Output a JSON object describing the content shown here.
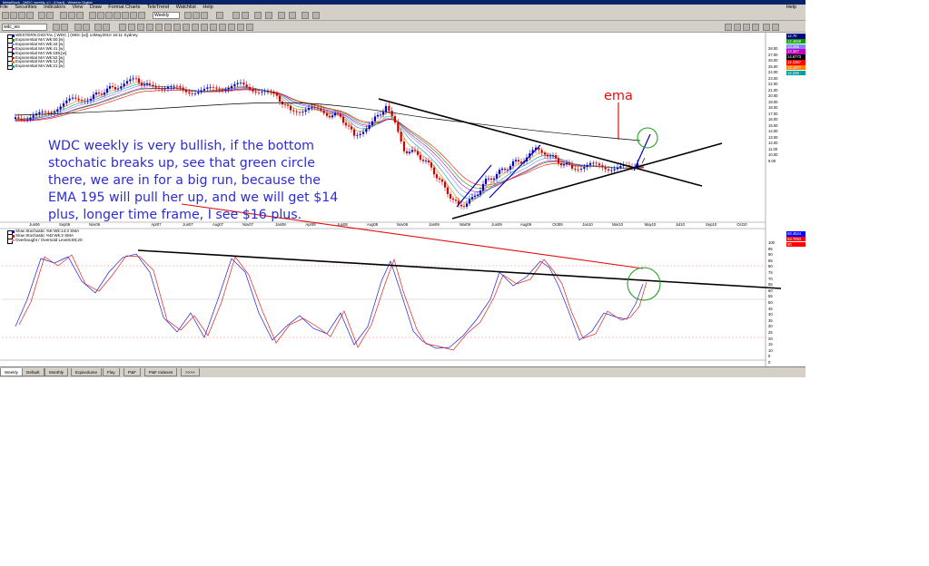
{
  "window": {
    "title": "MetaStock - [WDC weekly, c:\\...\\Chart] - Western Digital"
  },
  "menu": {
    "items": [
      "File",
      "Securities",
      "Indicators",
      "View",
      "Draw",
      "Format Charts",
      "TeleTrend",
      "Watchlist",
      "Help"
    ],
    "window_help": "Help"
  },
  "toolbar": {
    "period_value": "Weekly",
    "symbol_value": "wdc_ws"
  },
  "chart": {
    "header": "WESTERN DIGITAL [ WDC ] (WDc [w]) 13May2010 16:11 Sydney",
    "legend": [
      {
        "label": "Exponential MA:Wk:50:[w]",
        "color": "#00a000"
      },
      {
        "label": "Exponential MA:Wk:34:[w]",
        "color": "#8080ff"
      },
      {
        "label": "Exponential MA:Wk:41:[w]",
        "color": "#c000c0"
      },
      {
        "label": "Exponential MA:Wk:195:[w]",
        "color": "#000000"
      },
      {
        "label": "Exponential MA:Wk:52:[w]",
        "color": "#ff0000"
      },
      {
        "label": "Exponential MA:Wk:12:[w]",
        "color": "#ff8000"
      },
      {
        "label": "Exponential MA:Wk:21:[w]",
        "color": "#00a0a0"
      }
    ],
    "right_axis": [
      "28.00",
      "27.00",
      "26.00",
      "25.00",
      "24.00",
      "23.00",
      "22.00",
      "21.00",
      "20.00",
      "19.00",
      "18.00",
      "17.00",
      "16.00",
      "15.00",
      "14.00",
      "13.00",
      "12.00",
      "11.00",
      "10.00",
      "9.00"
    ],
    "right_badges": [
      {
        "value": "12.70",
        "color": "#000080"
      },
      {
        "value": "12.4658",
        "color": "#00a000"
      },
      {
        "value": "13.205",
        "color": "#8080ff"
      },
      {
        "value": "13.327",
        "color": "#c000c0"
      },
      {
        "value": "14.6773",
        "color": "#000000"
      },
      {
        "value": "12.2357",
        "color": "#ff0000"
      },
      {
        "value": "12.1477",
        "color": "#ff8000"
      },
      {
        "value": "12.338",
        "color": "#00a0a0"
      }
    ],
    "x_axis": [
      "Jun06",
      "Sep06",
      "Nov06",
      "Apr07",
      "Jun07",
      "Aug07",
      "Nov07",
      "Jan08",
      "Apr08",
      "Jun08",
      "Aug08",
      "Nov08",
      "Jan09",
      "Mar09",
      "Jun09",
      "Aug09",
      "Oct09",
      "Jan10",
      "Mar10",
      "May10",
      "Jul10",
      "Sep10",
      "Oct10"
    ]
  },
  "indicator": {
    "legend": [
      {
        "label": "Slow Stochastic %K:Wk:14:3 SMA",
        "color": "#0000ff"
      },
      {
        "label": "Slow Stochastic %D:Wk:3 SMA",
        "color": "#ff0000"
      },
      {
        "label": "Overbought / Oversold Levels:80;20",
        "color": "#ff8080"
      }
    ],
    "right_axis": [
      "100",
      "95",
      "90",
      "85",
      "80",
      "75",
      "70",
      "65",
      "60",
      "55",
      "50",
      "45",
      "40",
      "35",
      "30",
      "25",
      "20",
      "15",
      "10",
      "5",
      "0"
    ],
    "right_badges": [
      {
        "value": "68.4524",
        "color": "#0000ff"
      },
      {
        "value": "63.7063",
        "color": "#ff0000"
      },
      {
        "value": "80",
        "color": "#ff0000"
      }
    ]
  },
  "annotation": {
    "text": "WDC weekly is very bullish, if the bottom stochatic breaks up, see that green circle there, we are in for a big run, because the EMA 195 will pull her up, and we will get $14 plus, longer time frame, I see $16 plus.",
    "ema_label": "ema"
  },
  "tabs": [
    "Weekly",
    "Default",
    "Monthly",
    "Equivolume",
    "Flay",
    "P&F",
    "P&F Indexes",
    ">>>>"
  ]
}
